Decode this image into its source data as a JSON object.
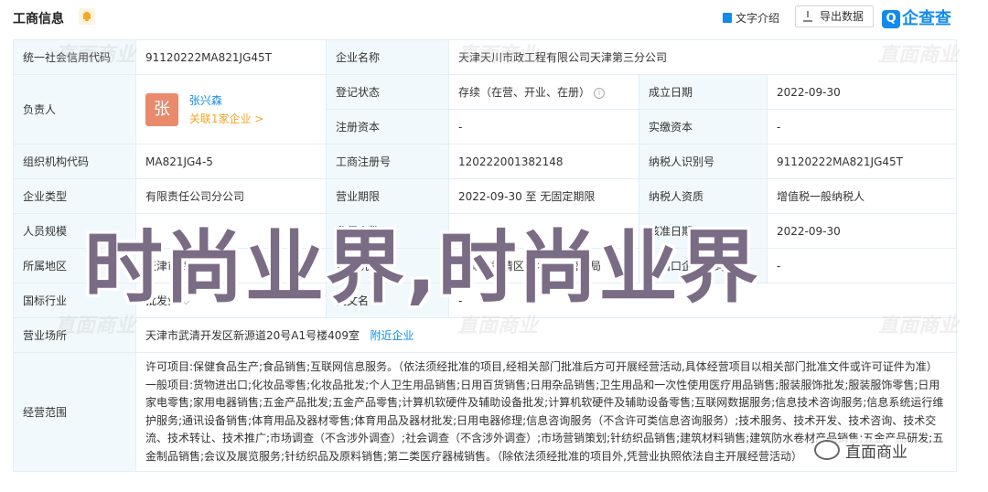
{
  "header": {
    "title": "工商信息",
    "intro_label": "文字介绍",
    "export_label": "导出数据",
    "logo_text": "企查查",
    "logo_mark": "Q"
  },
  "rows": {
    "credit_code_label": "统一社会信用代码",
    "credit_code": "91120222MA821JG45T",
    "company_name_label": "企业名称",
    "company_name": "天津天川市政工程有限公司天津第三分公司",
    "legal_label": "负责人",
    "avatar_char": "张",
    "person_name": "张兴森",
    "person_rel": "关联1家企业 >",
    "status_label": "登记状态",
    "status": "存续（在营、开业、在册）",
    "est_date_label": "成立日期",
    "est_date": "2022-09-30",
    "reg_capital_label": "注册资本",
    "reg_capital": "-",
    "paid_capital_label": "实缴资本",
    "paid_capital": "-",
    "org_code_label": "组织机构代码",
    "org_code": "MA821JG4-5",
    "reg_no_label": "工商注册号",
    "reg_no": "120222001382148",
    "tax_id_label": "纳税人识别号",
    "tax_id": "91120222MA821JG45T",
    "type_label": "企业类型",
    "type": "有限责任公司分公司",
    "term_label": "营业期限",
    "term": "2022-09-30 至 无固定期限",
    "tax_qual_label": "纳税人资质",
    "tax_qual": "增值税一般纳税人",
    "staff_label": "人员规模",
    "staff": "-",
    "insured_label": "参保人数",
    "insured": "-",
    "approve_label": "核准日期",
    "approve": "2022-09-30",
    "region_label": "所属地区",
    "region": "天津市武清区",
    "authority_label": "登记机关",
    "authority": "天津市武清区市场监督管理局",
    "iecode_label": "进出口企业代码",
    "iecode": "-",
    "industry_label": "国标行业",
    "industry": "批发业",
    "en_name_label": "英文名",
    "en_name": "-",
    "address_label": "营业场所",
    "address": "天津市武清开发区新源道20号A1号楼409室",
    "nearby": "附近企业",
    "scope_label": "经营范围",
    "scope": "许可项目:保健食品生产;食品销售;互联网信息服务。（依法须经批准的项目,经相关部门批准后方可开展经营活动,具体经营项目以相关部门批准文件或许可证件为准）一般项目:货物进出口;化妆品零售;化妆品批发;个人卫生用品销售;日用百货销售;日用杂品销售;卫生用品和一次性使用医疗用品销售;服装服饰批发;服装服饰零售;日用家电零售;家用电器销售;五金产品批发;五金产品零售;计算机软硬件及辅助设备批发;计算机软硬件及辅助设备零售;互联网数据服务;信息技术咨询服务;信息系统运行维护服务;通讯设备销售;体育用品及器材零售;体育用品及器材批发;日用电器修理;信息咨询服务（不含许可类信息咨询服务）;技术服务、技术开发、技术咨询、技术交流、技术转让、技术推广;市场调查（不含涉外调查）;社会调查（不含涉外调查）;市场营销策划;针纺织品销售;建筑材料销售;建筑防水卷材产品销售;五金产品研发;五金制品销售;会议及展览服务;针纺织品及原料销售;第二类医疗器械销售。（除依法须经批准的项目外,凭营业执照依法自主开展经营活动）"
  },
  "watermark_text": "直面商业",
  "overlay_text": "时尚业界,时尚业界",
  "wechat_text": "直面商业",
  "colors": {
    "accent": "#128bed",
    "label_bg": "#f2f9fc",
    "avatar": "#ea8a6c",
    "relation": "#f5a623",
    "overlay": "#7b6c86"
  }
}
